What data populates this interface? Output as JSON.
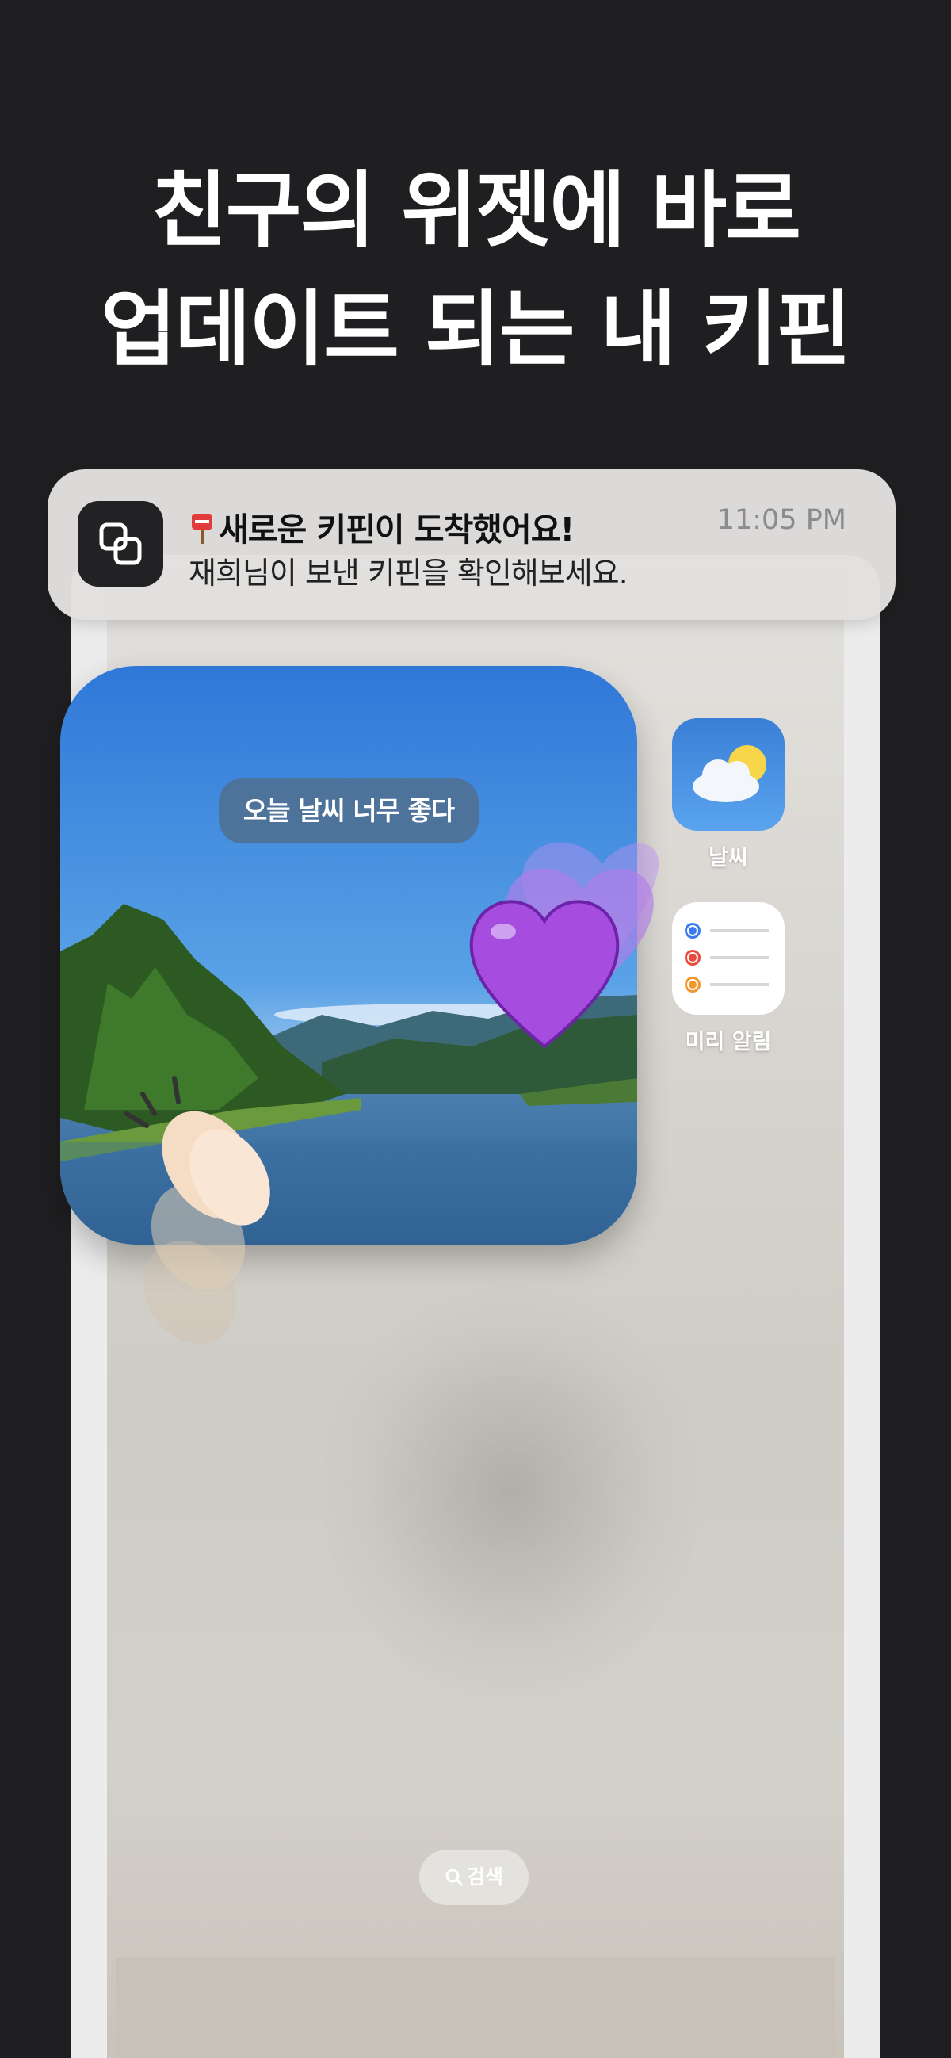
{
  "headline": {
    "line1": "친구의 위젯에 바로",
    "line2": "업데이트 되는 내 키핀"
  },
  "notification": {
    "app_icon": "overlapping-squares-icon",
    "title_emoji": "postbox-icon",
    "title": "새로운 키핀이 도착했어요!",
    "body": "재희님이 보낸 키핀을 확인해보세요.",
    "time": "11:05 PM"
  },
  "photo_widget": {
    "caption": "오늘 날씨 너무 좋다",
    "reactions": [
      "purple-heart-icon",
      "clapping-hands-icon"
    ]
  },
  "apps": [
    {
      "label": "날씨",
      "icon": "weather-icon"
    },
    {
      "label": "미리 알림",
      "icon": "reminders-icon"
    }
  ],
  "search": {
    "label": "검색",
    "icon": "search-icon"
  },
  "colors": {
    "background": "#1f1f21",
    "purple_heart": "#a64de0",
    "notification_bg": "#e1e0de"
  }
}
